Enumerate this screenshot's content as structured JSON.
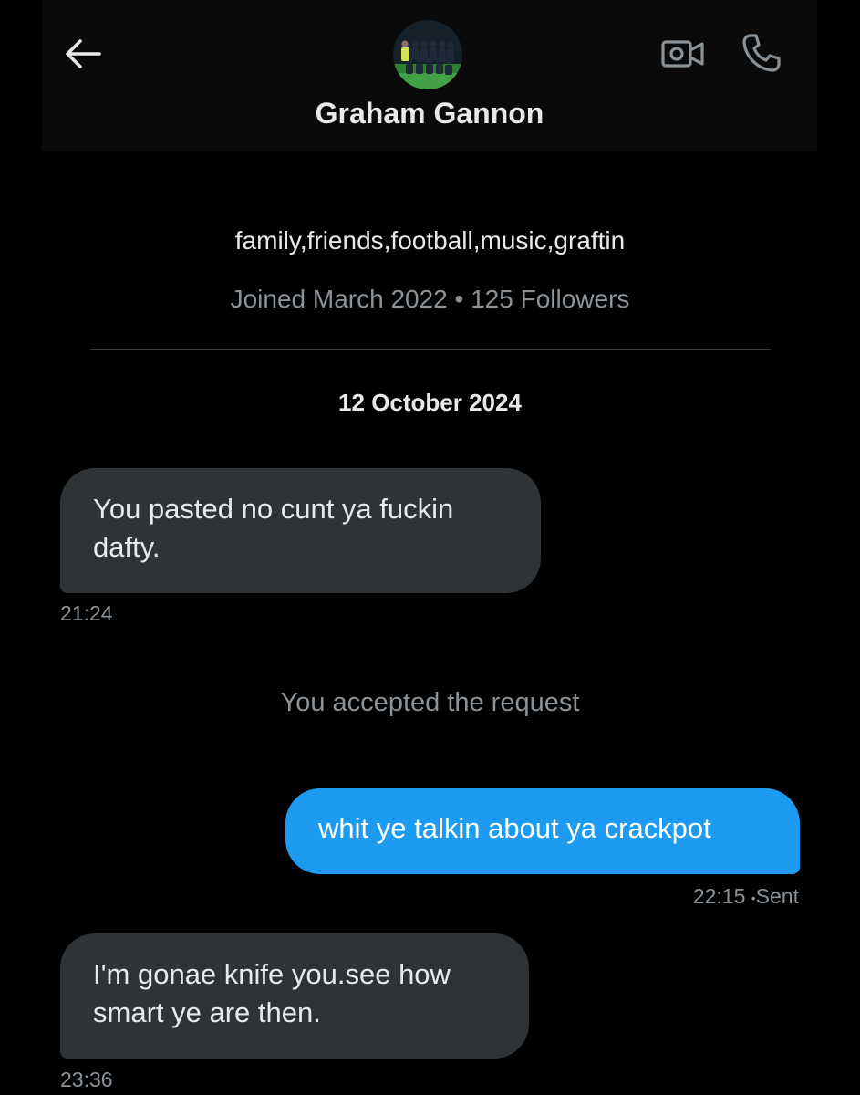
{
  "header": {
    "contact_name": "Graham Gannon",
    "icons": {
      "back": "arrow-left-icon",
      "video": "video-camera-icon",
      "phone": "phone-icon"
    }
  },
  "profile": {
    "bio": "family,friends,football,music,graftin",
    "joined": "Joined March 2022",
    "separator": "•",
    "followers": "125 Followers"
  },
  "conversation": {
    "date": "12 October 2024",
    "messages": [
      {
        "direction": "incoming",
        "text": "You pasted no cunt ya fuckin dafty.",
        "time": "21:24"
      },
      {
        "direction": "system",
        "text": "You accepted the request"
      },
      {
        "direction": "outgoing",
        "text": "whit ye talkin about ya crackpot",
        "time": "22:15",
        "status": "Sent"
      },
      {
        "direction": "incoming",
        "text": "I'm gonae knife you.see how smart ye are then.",
        "time": "23:36"
      }
    ]
  },
  "colors": {
    "background": "#000000",
    "header_background": "#0a0a0a",
    "incoming_bubble": "#2f3336",
    "outgoing_bubble": "#1d9bf0",
    "secondary_text": "#8b9298"
  }
}
